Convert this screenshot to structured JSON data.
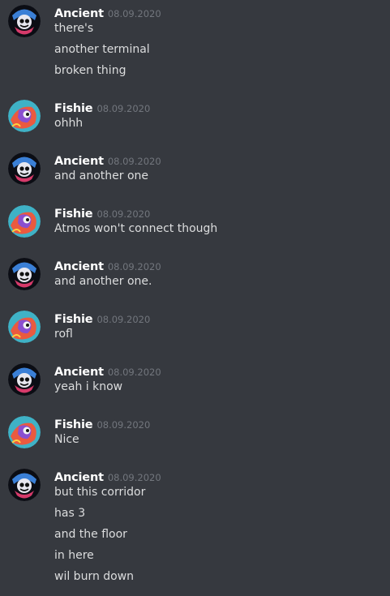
{
  "users": {
    "ancient": {
      "name": "Ancient",
      "avatar": "ancient-avatar"
    },
    "fishie": {
      "name": "Fishie",
      "avatar": "fishie-avatar"
    }
  },
  "messages": [
    {
      "author": "Ancient",
      "timestamp": "08.09.2020",
      "lines": [
        "there's",
        "another terminal",
        "broken thing"
      ]
    },
    {
      "author": "Fishie",
      "timestamp": "08.09.2020",
      "lines": [
        "ohhh"
      ]
    },
    {
      "author": "Ancient",
      "timestamp": "08.09.2020",
      "lines": [
        "and another one"
      ]
    },
    {
      "author": "Fishie",
      "timestamp": "08.09.2020",
      "lines": [
        "Atmos won't connect though"
      ]
    },
    {
      "author": "Ancient",
      "timestamp": "08.09.2020",
      "lines": [
        "and another one."
      ]
    },
    {
      "author": "Fishie",
      "timestamp": "08.09.2020",
      "lines": [
        "rofl"
      ]
    },
    {
      "author": "Ancient",
      "timestamp": "08.09.2020",
      "lines": [
        "yeah i know"
      ]
    },
    {
      "author": "Fishie",
      "timestamp": "08.09.2020",
      "lines": [
        "Nice"
      ]
    },
    {
      "author": "Ancient",
      "timestamp": "08.09.2020",
      "lines": [
        "but this corridor",
        "has 3",
        "and the floor",
        "in here",
        "wil burn down"
      ]
    }
  ],
  "colors": {
    "background": "#36393f",
    "author": "#ffffff",
    "timestamp": "#72767d",
    "message_text": "#dcddde"
  }
}
